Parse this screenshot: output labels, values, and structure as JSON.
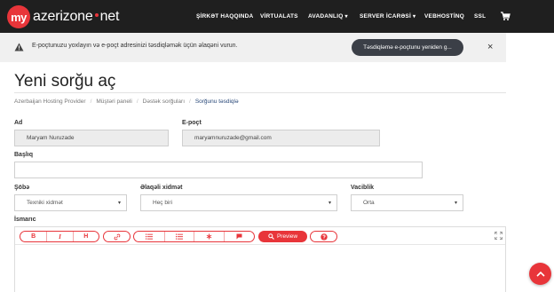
{
  "brand": {
    "prefix": "my",
    "name": "azerizone",
    "suffix": "net",
    "accent": "#e8353a"
  },
  "nav": {
    "items": [
      {
        "label": "ŞİRKƏT HAQQINDA"
      },
      {
        "label": "VİRTUALATS"
      },
      {
        "label": "AVADANLIQ"
      },
      {
        "label": "SERVER İCARƏSİ"
      },
      {
        "label": "VEBHOSTİNQ"
      },
      {
        "label": "SSL"
      }
    ],
    "cart_icon": "cart-icon"
  },
  "alert": {
    "text": "E-poçtunuzu yoxlayın və e-poçt adresinizi təsdiqləmək üçün əlaqəni vurun.",
    "button": "Təsdiqləmə e-poçtunu yeniden g...",
    "close": "×"
  },
  "page": {
    "title": "Yeni sorğu aç"
  },
  "breadcrumb": {
    "items": [
      "Azerbaijan Hosting Provider",
      "Müştəri paneli",
      "Dəstək sorğuları",
      "Sorğunu təsdiqlə"
    ],
    "separator": "/"
  },
  "form": {
    "name_label": "Ad",
    "name_value": "Maryam Nuruzade",
    "email_label": "E-poçt",
    "email_value": "maryamnuruzade@gmail.com",
    "subject_label": "Başlıq",
    "subject_value": "",
    "department_label": "Şöbə",
    "department_value": "Texniki xidmət",
    "service_label": "Əlaqəli xidmət",
    "service_value": "Heç biri",
    "priority_label": "Vaciblik",
    "priority_value": "Orta",
    "message_label": "İsmarıc"
  },
  "editor": {
    "bold": "B",
    "italic": "I",
    "heading": "H",
    "preview": "Preview"
  }
}
